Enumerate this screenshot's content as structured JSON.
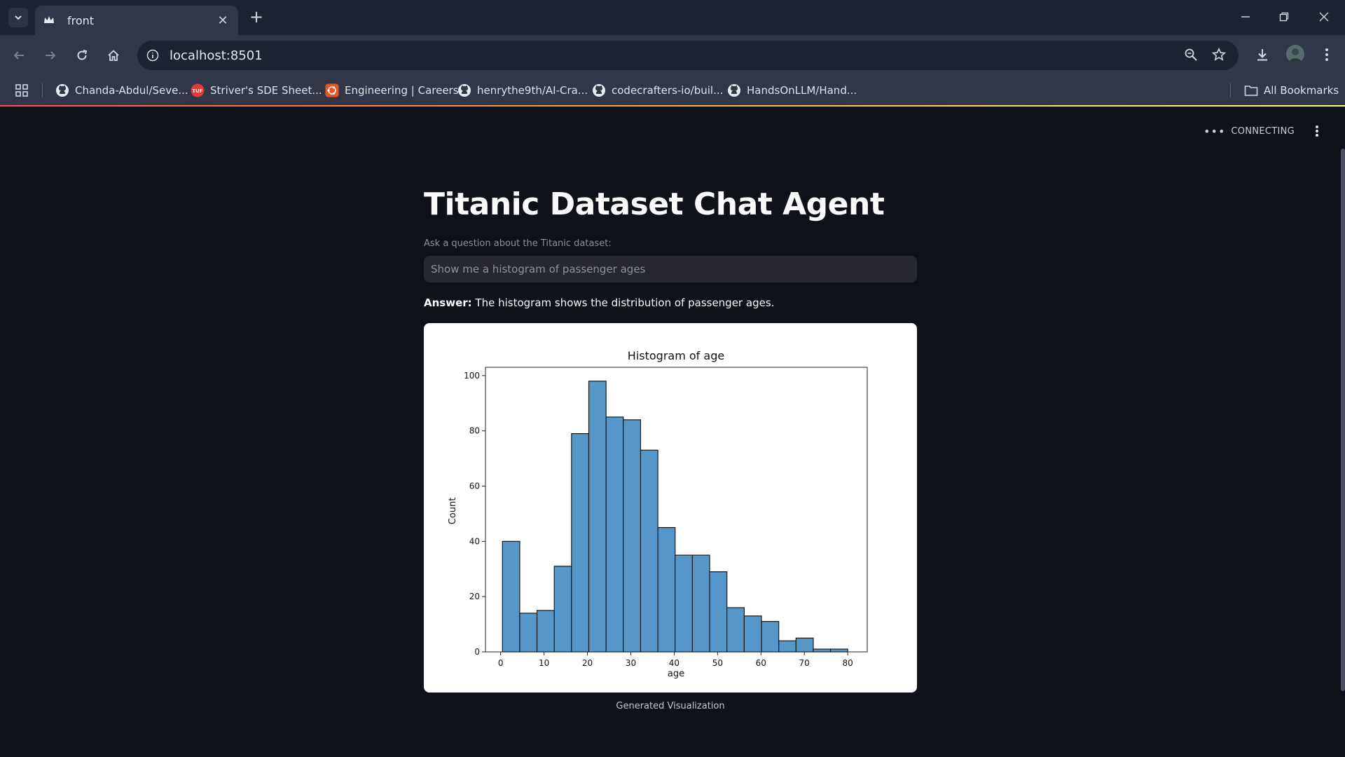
{
  "browser": {
    "tab_title": "front",
    "url": "localhost:8501",
    "bookmarks": [
      {
        "label": "Chanda-Abdul/Seve...",
        "icon": "github-icon"
      },
      {
        "label": "Striver's SDE Sheet...",
        "icon": "tuf-icon"
      },
      {
        "label": "Engineering | Careers",
        "icon": "ubuntu-icon"
      },
      {
        "label": "henrythe9th/AI-Cra...",
        "icon": "github-icon"
      },
      {
        "label": "codecrafters-io/buil...",
        "icon": "github-icon"
      },
      {
        "label": "HandsOnLLM/Hand...",
        "icon": "github-icon"
      }
    ],
    "all_bookmarks": "All Bookmarks"
  },
  "app": {
    "status": "CONNECTING",
    "title": "Titanic Dataset Chat Agent",
    "input_label": "Ask a question about the Titanic dataset:",
    "input_value": "Show me a histogram of passenger ages",
    "answer_label": "Answer:",
    "answer_text": " The histogram shows the distribution of passenger ages.",
    "caption": "Generated Visualization"
  },
  "colors": {
    "bar_fill": "#5497c8",
    "bar_stroke": "#1a1a1a",
    "accent_red": "#ff4b4b"
  },
  "chart_data": {
    "type": "bar",
    "title": "Histogram of age",
    "xlabel": "age",
    "ylabel": "Count",
    "xlim": [
      -3.5,
      84.5
    ],
    "ylim": [
      0,
      103
    ],
    "x_ticks": [
      0,
      10,
      20,
      30,
      40,
      50,
      60,
      70,
      80
    ],
    "y_ticks": [
      0,
      20,
      40,
      60,
      80,
      100
    ],
    "bins": [
      {
        "x0": 0.42,
        "x1": 4.4,
        "count": 40
      },
      {
        "x0": 4.4,
        "x1": 8.38,
        "count": 14
      },
      {
        "x0": 8.38,
        "x1": 12.36,
        "count": 15
      },
      {
        "x0": 12.36,
        "x1": 16.34,
        "count": 31
      },
      {
        "x0": 16.34,
        "x1": 20.32,
        "count": 79
      },
      {
        "x0": 20.32,
        "x1": 24.3,
        "count": 98
      },
      {
        "x0": 24.3,
        "x1": 28.28,
        "count": 85
      },
      {
        "x0": 28.28,
        "x1": 32.26,
        "count": 84
      },
      {
        "x0": 32.26,
        "x1": 36.24,
        "count": 73
      },
      {
        "x0": 36.24,
        "x1": 40.22,
        "count": 45
      },
      {
        "x0": 40.22,
        "x1": 44.2,
        "count": 35
      },
      {
        "x0": 44.2,
        "x1": 48.18,
        "count": 35
      },
      {
        "x0": 48.18,
        "x1": 52.16,
        "count": 29
      },
      {
        "x0": 52.16,
        "x1": 56.14,
        "count": 16
      },
      {
        "x0": 56.14,
        "x1": 60.12,
        "count": 13
      },
      {
        "x0": 60.12,
        "x1": 64.1,
        "count": 11
      },
      {
        "x0": 64.1,
        "x1": 68.08,
        "count": 4
      },
      {
        "x0": 68.08,
        "x1": 72.06,
        "count": 5
      },
      {
        "x0": 72.06,
        "x1": 76.04,
        "count": 1
      },
      {
        "x0": 76.04,
        "x1": 80.0,
        "count": 1
      }
    ],
    "grid": false,
    "legend": "none"
  }
}
